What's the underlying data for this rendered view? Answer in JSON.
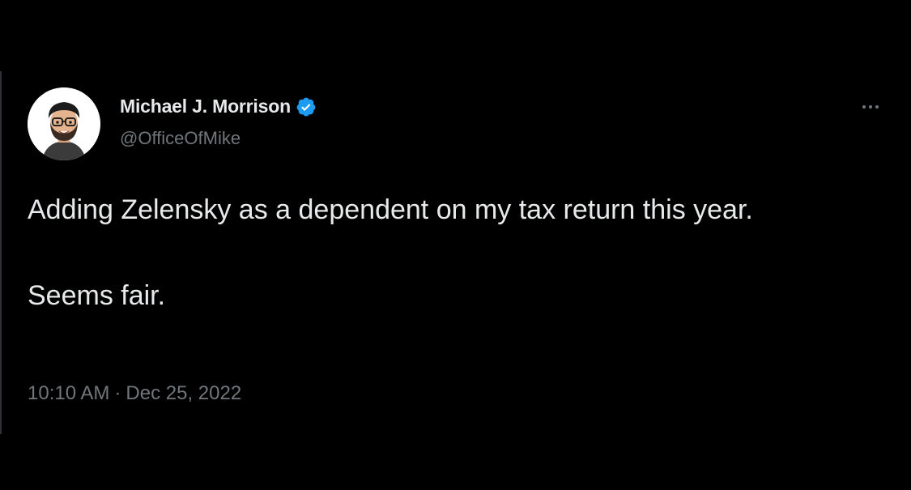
{
  "tweet": {
    "author": {
      "display_name": "Michael J. Morrison",
      "handle": "@OfficeOfMike",
      "verified": true,
      "avatar_icon": "bitmoji-avatar-icon"
    },
    "more_icon": "more-horizontal-icon",
    "text": {
      "line1": "Adding Zelensky as a dependent on my tax return this year.",
      "line2": "Seems fair."
    },
    "time": "10:10 AM",
    "separator": "·",
    "date": "Dec 25, 2022"
  },
  "colors": {
    "background": "#000000",
    "primary_text": "#e7e9ea",
    "secondary_text": "#71767b",
    "verified_badge": "#1d9bf0",
    "divider": "#2f3336"
  }
}
